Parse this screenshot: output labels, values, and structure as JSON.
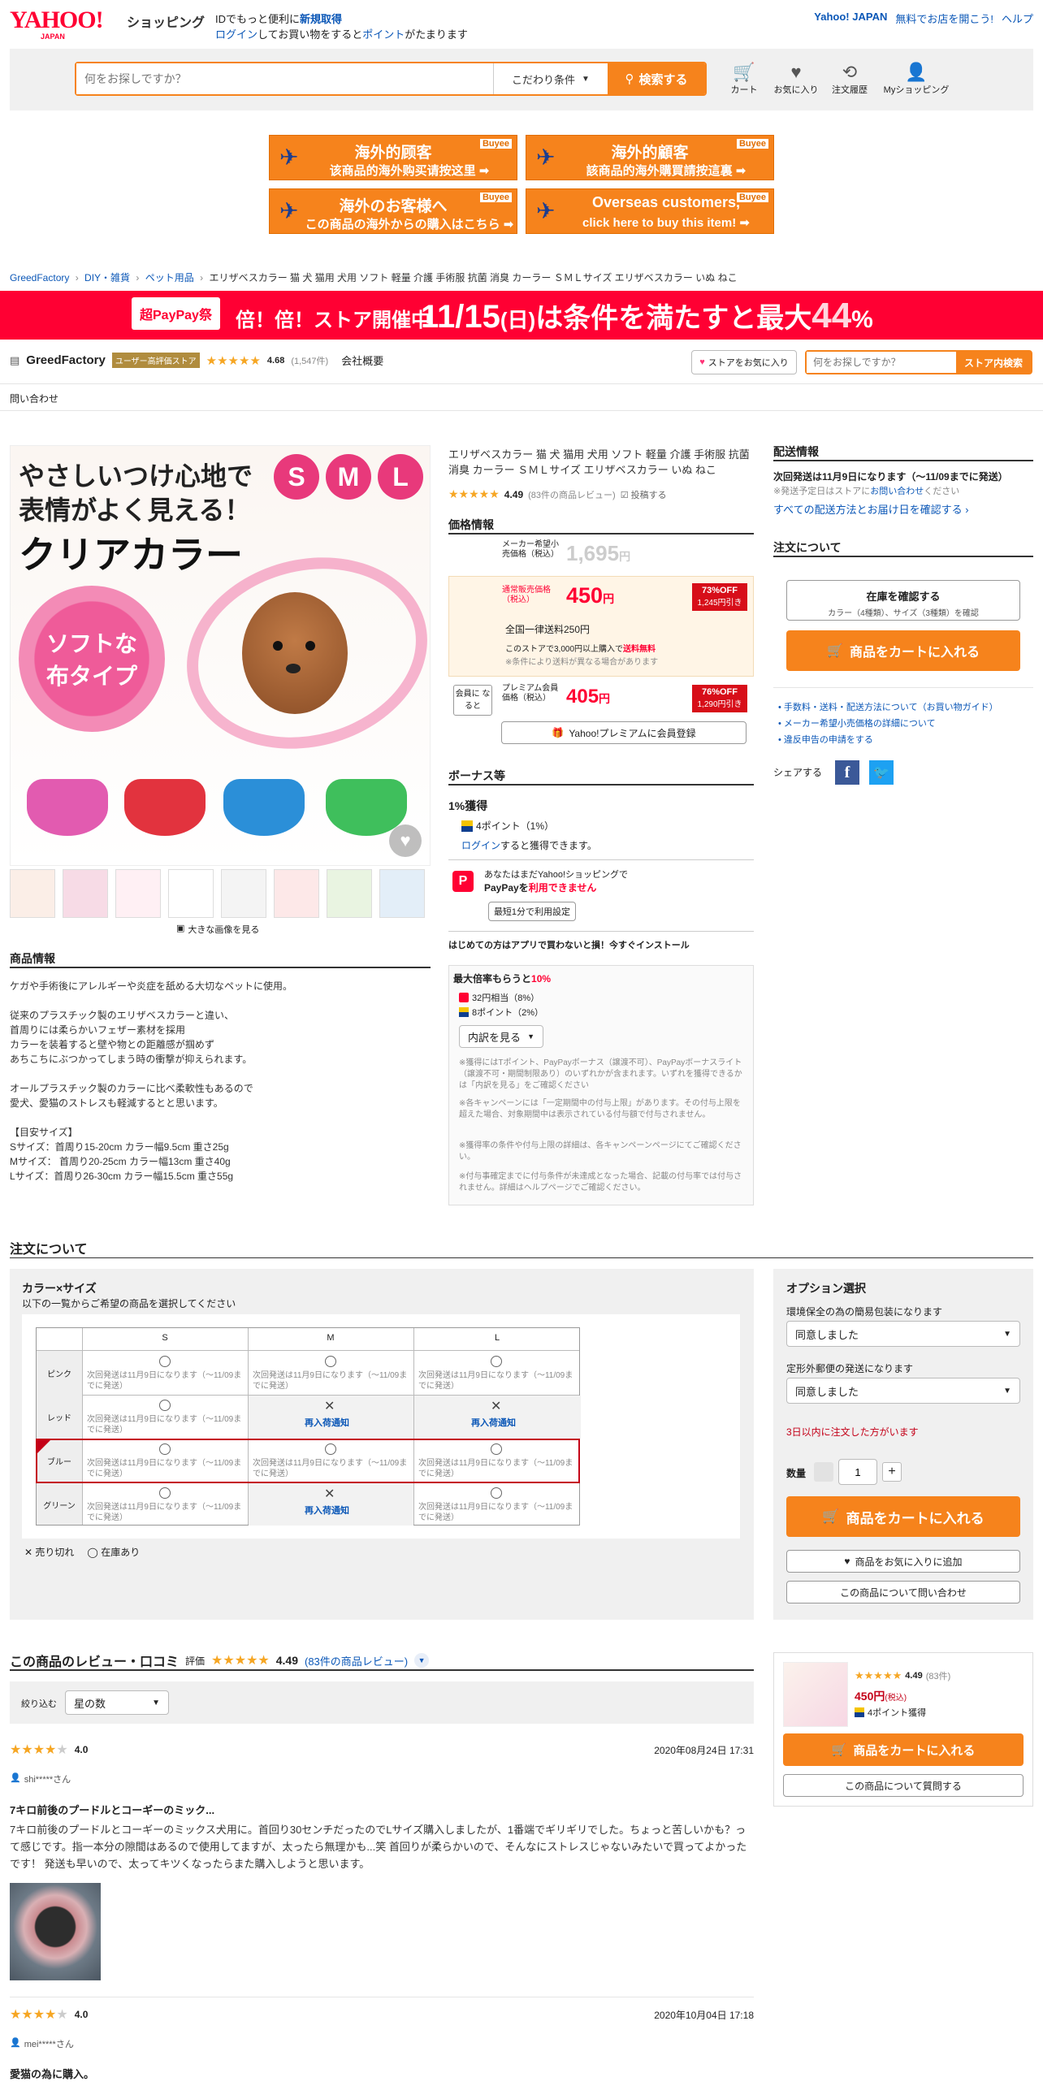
{
  "header": {
    "logo_line1": "YAHOO!",
    "logo_line2": "JAPAN",
    "logo_sub": "ショッピング",
    "id_msg_prefix": "IDでもっと便利に",
    "id_msg_link": "新規取得",
    "login_link": "ログイン",
    "login_suffix_a": "してお買い物をすると",
    "login_suffix_link": "ポイント",
    "login_suffix_b": "がたまります",
    "top_right_a": "Yahoo! JAPAN",
    "top_right_b": "無料でお店を開こう!",
    "top_right_c": "ヘルプ"
  },
  "search": {
    "placeholder": "何をお探しですか？",
    "condition_label": "こだわり条件",
    "button_label": "検索する"
  },
  "nav_icons": [
    {
      "label": "カート",
      "icon": "cart-icon"
    },
    {
      "label": "お気に入り",
      "icon": "heart-icon"
    },
    {
      "label": "注文履歴",
      "icon": "history-icon"
    },
    {
      "label": "Myショッピング",
      "icon": "person-icon"
    }
  ],
  "overseas_banners": [
    {
      "line1": "海外的顾客",
      "line2": "该商品的海外购买请按这里 ➡",
      "badge": "Buyee"
    },
    {
      "line1": "海外的顧客",
      "line2": "該商品的海外購買請按這裏 ➡",
      "badge": "Buyee"
    },
    {
      "line1": "海外のお客様へ",
      "line2": "この商品の海外からの購入はこちら ➡",
      "badge": "Buyee"
    },
    {
      "line1": "Overseas customers,",
      "line2": "click here to buy this item! ➡",
      "badge": "Buyee"
    }
  ],
  "breadcrumb": [
    "GreedFactory",
    "DIY・雑貨",
    "ペット用品",
    "エリザベスカラー 猫 犬 猫用 犬用 ソフト 軽量 介護 手術服 抗菌 消臭 カーラー ＳＭＬサイズ エリザベスカラー いぬ ねこ"
  ],
  "campaign": {
    "badge": "超PayPay祭",
    "text_a": "倍！倍！ストア開催中",
    "date": "11/15",
    "weekday": "(日)",
    "text_b": "は条件を満たすと最大",
    "percent": "44",
    "pct": "%"
  },
  "store": {
    "name": "GreedFactory",
    "award": "ユーザー高評価ストア",
    "rating": "4.68",
    "count": "(1,547件)",
    "overview": "会社概要",
    "fav_button": "ストアをお気に入り",
    "search_placeholder": "何をお探しですか？",
    "search_button": "ストア内検索",
    "inquiry": "問い合わせ"
  },
  "hero": {
    "line1": "やさしいつけ心地で",
    "line2": "表情がよく見える！",
    "line3": "クリアカラー",
    "flower_line1": "ソフトな",
    "flower_line2": "布タイプ",
    "sizes": [
      "S",
      "M",
      "L"
    ],
    "enlarge": "大きな画像を見る"
  },
  "product": {
    "title": "エリザベスカラー 猫 犬 猫用 犬用 ソフト 軽量 介護 手術服 抗菌 消臭 カーラー ＳＭＬサイズ エリザベスカラー いぬ ねこ",
    "rating": "4.49",
    "review_count": "(83件の商品レビュー)",
    "post_review": "投稿する",
    "price_section": "価格情報",
    "maker_label": "メーカー希望小売価格（税込）",
    "maker_price": "1,695",
    "yen": "円",
    "normal_label": "通常販売価格（税込）",
    "normal_price": "450",
    "normal_off": "73%OFF",
    "normal_off_sub": "1,245円引き",
    "shipping": "全国一律送料250円",
    "free_ship_a": "このストアで3,000円以上購入で",
    "free_ship_b": "送料無料",
    "free_ship_note": "※条件により送料が異なる場合があります",
    "member_tag": "会員に なると",
    "premium_label": "プレミアム会員価格（税込）",
    "premium_price": "405",
    "premium_off": "76%OFF",
    "premium_off_sub": "1,290円引き",
    "premium_button": "Yahoo!プレミアムに会員登録",
    "bonus_title": "ボーナス等",
    "bonus_pct": "1%獲得",
    "bonus_points": "4ポイント（1%）",
    "bonus_login": "ログイン",
    "bonus_login_suffix": "すると獲得できます。",
    "paypay_a": "あなたはまだYahoo!ショッピングで",
    "paypay_b": "PayPayを",
    "paypay_c": "利用できません",
    "paypay_button": "最短1分で利用設定",
    "app_notice": "はじめての方はアプリで買わないと損！今すぐインストール",
    "max_title_a": "最大倍率もらうと",
    "max_title_b": "10%",
    "max_item1": "32円相当（8%）",
    "max_item2": "8ポイント（2%）",
    "max_button": "内訳を見る",
    "notes": [
      "※獲得にはTポイント、PayPayボーナス（譲渡不可）、PayPayボーナスライト（譲渡不可・期間制限あり）のいずれかが含まれます。いずれを獲得できるかは「内訳を見る」をご確認ください",
      "※各キャンペーンには「一定期間中の付与上限」があります。その付与上限を超えた場合、対象期間中は表示されている付与額で付与されません。",
      "※獲得率の条件や付与上限の詳細は、各キャンペーンページにてご確認ください。",
      "※付与事確定までに付与条件が未達成となった場合、記載の付与率では付与されません。詳細はヘルプページでご確認ください。"
    ]
  },
  "right_panel": {
    "delivery_title": "配送情報",
    "delivery_main": "次回発送は11月9日になります（〜11/09までに発送）",
    "delivery_note_a": "※発送予定日はストアに",
    "delivery_note_link": "お問い合わせ",
    "delivery_note_b": "ください",
    "delivery_link": "すべての配送方法とお届け日を確認する",
    "order_title": "注文について",
    "stock_check": "在庫を確認する",
    "stock_sub": "カラー（4種類）、サイズ（3種類）を確認",
    "cart_button": "商品をカートに入れる",
    "links": [
      "手数料・送料・配送方法について（お買い物ガイド）",
      "メーカー希望小売価格の詳細について",
      "違反申告の申請をする"
    ],
    "share": "シェアする"
  },
  "description": {
    "title": "商品情報",
    "lines": [
      "ケガや手術後にアレルギーや炎症を舐める大切なペットに使用。",
      "",
      "従来のプラスチック製のエリザベスカラーと違い、",
      "首周りには柔らかいフェザー素材を採用",
      "カラーを装着すると壁や物との距離感が掴めず",
      "あちこちにぶつかってしまう時の衝撃が抑えられます。",
      "",
      "オールプラスチック製のカラーに比べ柔軟性もあるので",
      "愛犬、愛猫のストレスも軽減するとと思います。",
      "",
      "【目安サイズ】",
      "Sサイズ：首周り15-20cm カラー幅9.5cm 重さ25g",
      "Mサイズ： 首周り20-25cm カラー幅13cm 重さ40g",
      "Lサイズ：首周り26-30cm カラー幅15.5cm 重さ55g"
    ]
  },
  "order": {
    "title": "注文について",
    "variant_title": "カラー×サイズ",
    "variant_sub": "以下の一覧からご希望の商品を選択してください",
    "sizes": [
      "S",
      "M",
      "L"
    ],
    "rows": [
      {
        "color": "ピンク",
        "cells": [
          "次回発送は11月9日になります（〜11/09までに発送）",
          "次回発送は11月9日になります（〜11/09までに発送）",
          "次回発送は11月9日になります（〜11/09までに発送）"
        ],
        "soldout": [
          false,
          false,
          false
        ]
      },
      {
        "color": "レッド",
        "cells": [
          "次回発送は11月9日になります（〜11/09までに発送）",
          "再入荷通知",
          "再入荷通知"
        ],
        "soldout": [
          false,
          true,
          true
        ]
      },
      {
        "color": "ブルー",
        "cells": [
          "次回発送は11月9日になります（〜11/09までに発送）",
          "次回発送は11月9日になります（〜11/09までに発送）",
          "次回発送は11月9日になります（〜11/09までに発送）"
        ],
        "soldout": [
          false,
          false,
          false
        ]
      },
      {
        "color": "グリーン",
        "cells": [
          "次回発送は11月9日になります（〜11/09までに発送）",
          "再入荷通知",
          "次回発送は11月9日になります（〜11/09までに発送）"
        ],
        "soldout": [
          false,
          true,
          false
        ]
      }
    ],
    "legend_soldout": "売り切れ",
    "legend_instock": "在庫あり",
    "option_title": "オプション選択",
    "opt1_label": "環境保全の為の簡易包装になります",
    "opt1_value": "同意しました",
    "opt2_label": "定形外郵便の発送になります",
    "opt2_value": "同意しました",
    "warning": "3日以内に注文した方がいます",
    "qty_label": "数量",
    "qty_value": "1",
    "cart_button": "商品をカートに入れる",
    "fav_button": "商品をお気に入りに追加",
    "ask_button": "この商品について問い合わせ"
  },
  "reviews": {
    "title": "この商品のレビュー・口コミ",
    "rating_label": "評価",
    "rating": "4.49",
    "count_link": "(83件の商品レビュー)",
    "filter_label": "絞り込む",
    "filter_value": "星の数",
    "items": [
      {
        "score": "4.0",
        "date": "2020年08月24日 17:31",
        "user": "shi*****さん",
        "title": "7キロ前後のプードルとコーギーのミック...",
        "body": "7キロ前後のプードルとコーギーのミックス犬用に。首回り30センチだったのでLサイズ購入しましたが、1番端でギリギリでした。ちょっと苦しいかも？って感じです。指一本分の隙間はあるので使用してますが、太ったら無理かも...笑 首回りが柔らかいので、そんなにストレスじゃないみたいで買ってよかったです！ 発送も早いので、太ってキツくなったらまた購入しようと思います。"
      },
      {
        "score": "4.0",
        "date": "2020年10月04日 17:18",
        "user": "mei*****さん",
        "title": "愛猫の為に購入。",
        "body": ""
      }
    ]
  },
  "sticky": {
    "rating": "4.49",
    "count": "(83件)",
    "price": "450円",
    "tax": "(税込)",
    "points": "4ポイント獲得",
    "cart_button": "商品をカートに入れる",
    "ask_button": "この商品について質問する"
  },
  "colors": {
    "orange": "#f6831c",
    "red": "#ff0033",
    "link": "#0b57b7",
    "premium_bg": "#fff5e6"
  }
}
